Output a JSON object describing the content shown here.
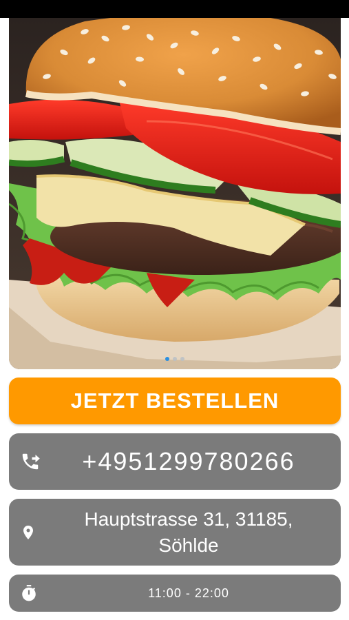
{
  "hero": {
    "image_alt": "Burger mit Sesam-Brötchen, Tomate, Gurke, Käse, Fleisch und Salat",
    "carousel_count": 3,
    "carousel_active_index": 0
  },
  "order_button": {
    "label": "JETZT BESTELLEN",
    "color": "#ff9900"
  },
  "contact": {
    "phone": {
      "icon": "phone-forward-icon",
      "value": "+4951299780266"
    },
    "address": {
      "icon": "location-pin-icon",
      "value": "Hauptstrasse 31, 31185, Söhlde"
    },
    "hours": {
      "icon": "stopwatch-icon",
      "value": "11:00 - 22:00"
    },
    "card_color": "#7b7b7b"
  }
}
